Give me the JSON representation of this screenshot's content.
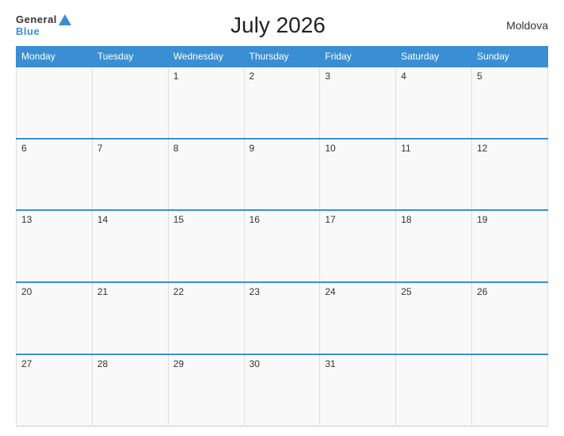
{
  "header": {
    "title": "July 2026",
    "country": "Moldova",
    "logo_general": "General",
    "logo_blue": "Blue"
  },
  "weekdays": [
    "Monday",
    "Tuesday",
    "Wednesday",
    "Thursday",
    "Friday",
    "Saturday",
    "Sunday"
  ],
  "weeks": [
    [
      "",
      "",
      "1",
      "2",
      "3",
      "4",
      "5"
    ],
    [
      "6",
      "7",
      "8",
      "9",
      "10",
      "11",
      "12"
    ],
    [
      "13",
      "14",
      "15",
      "16",
      "17",
      "18",
      "19"
    ],
    [
      "20",
      "21",
      "22",
      "23",
      "24",
      "25",
      "26"
    ],
    [
      "27",
      "28",
      "29",
      "30",
      "31",
      "",
      ""
    ]
  ]
}
